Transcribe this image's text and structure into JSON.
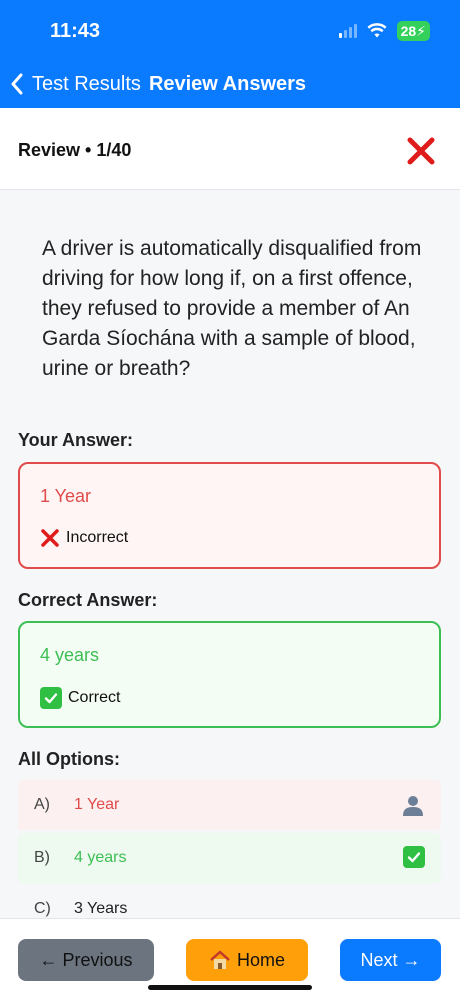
{
  "status_bar": {
    "time": "11:43",
    "battery": "28"
  },
  "nav": {
    "back_label": "Test Results",
    "title": "Review Answers"
  },
  "review": {
    "title": "Review • 1/40"
  },
  "question": {
    "text": "A driver is automatically disqualified from driving for how long if, on a first offence, they refused to provide a member of An Garda Síochána with a sample of blood, urine or breath?"
  },
  "your_answer": {
    "label": "Your Answer:",
    "value": "1 Year",
    "status": "Incorrect"
  },
  "correct_answer": {
    "label": "Correct Answer:",
    "value": "4 years",
    "status": "Correct"
  },
  "options": {
    "label": "All Options:",
    "items": [
      {
        "letter": "A)",
        "text": "1 Year"
      },
      {
        "letter": "B)",
        "text": "4 years"
      },
      {
        "letter": "C)",
        "text": "3 Years"
      }
    ]
  },
  "buttons": {
    "previous": "← Previous",
    "home": "Home",
    "next": "Next →"
  },
  "colors": {
    "accent": "#0a7aff",
    "wrong": "#e04b4b",
    "right": "#3cbf55",
    "home": "#ff9f0a"
  }
}
